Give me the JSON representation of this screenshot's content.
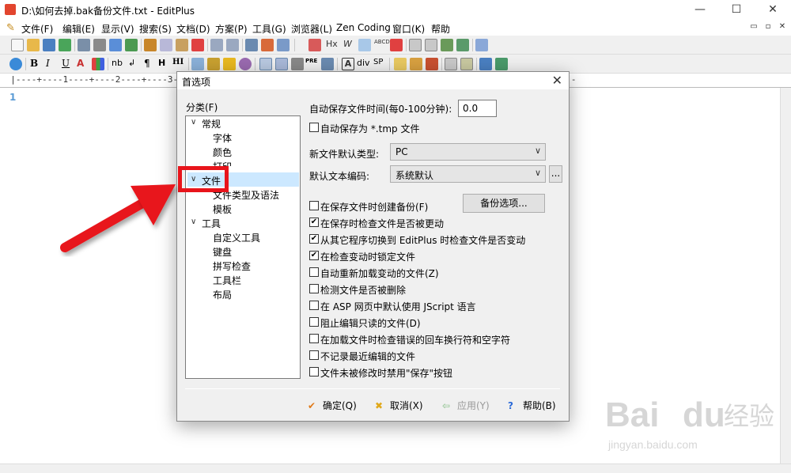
{
  "window": {
    "title": "D:\\如何去掉.bak备份文件.txt - EditPlus",
    "controls": [
      "—",
      "☐",
      "✕"
    ]
  },
  "menubar": {
    "items": [
      "文件(F)",
      "编辑(E)",
      "显示(V)",
      "搜索(S)",
      "文档(D)",
      "方案(P)",
      "工具(G)",
      "浏览器(L)",
      "Zen Coding",
      "窗口(K)",
      "帮助"
    ],
    "mdi_controls": [
      "▭",
      "▫",
      "✕"
    ]
  },
  "toolbar2_labels": {
    "b": "B",
    "i": "I",
    "u": "U",
    "nb": "nb",
    "pilcrow": "¶",
    "h": "H",
    "hi": "HI",
    "pre": "PRE",
    "div": "div",
    "sp": "SP",
    "a": "A",
    "hx": "Hx",
    "w": "W",
    "abcd": "ABCD"
  },
  "ruler": {
    "text": "  |----+----1----+----2----+----3----+----4----+----5----+----6----+----7----+----8----+----9----+----0-------"
  },
  "editor": {
    "line_number": "1"
  },
  "dialog": {
    "title": "首选项",
    "close": "✕",
    "category_label": "分类(F)",
    "tree": [
      {
        "label": "常规",
        "arrow": "∨"
      },
      {
        "label": "字体"
      },
      {
        "label": "颜色"
      },
      {
        "label": "打印"
      },
      {
        "label": "文件",
        "arrow": "∨"
      },
      {
        "label": "文件类型及语法"
      },
      {
        "label": "模板"
      },
      {
        "label": "工具",
        "arrow": "∨"
      },
      {
        "label": "自定义工具"
      },
      {
        "label": "键盘"
      },
      {
        "label": "拼写检查"
      },
      {
        "label": "工具栏"
      },
      {
        "label": "布局"
      }
    ],
    "autosave_label": "自动保存文件时间(每0-100分钟):",
    "autosave_value": "0.0",
    "autosave_tmp_label": "自动保存为 *.tmp 文件",
    "newfile_type_label": "新文件默认类型:",
    "newfile_type_value": "PC",
    "encoding_label": "默认文本编码:",
    "encoding_value": "系统默认",
    "encoding_more": "...",
    "backup_button": "备份选项...",
    "checkboxes": [
      {
        "label": "在保存文件时创建备份(F)",
        "checked": false
      },
      {
        "label": "在保存时检查文件是否被更动",
        "checked": true
      },
      {
        "label": "从其它程序切换到 EditPlus 时检查文件是否变动",
        "checked": true
      },
      {
        "label": "在检查变动时锁定文件",
        "checked": true
      },
      {
        "label": "自动重新加载变动的文件(Z)",
        "checked": false
      },
      {
        "label": "检测文件是否被删除",
        "checked": false
      },
      {
        "label": "在 ASP 网页中默认使用 JScript 语言",
        "checked": false
      },
      {
        "label": "阻止编辑只读的文件(D)",
        "checked": false
      },
      {
        "label": "在加载文件时检查错误的回车换行符和空字符",
        "checked": false
      },
      {
        "label": "不记录最近编辑的文件",
        "checked": false
      },
      {
        "label": "文件未被修改时禁用\"保存\"按钮",
        "checked": false
      }
    ],
    "footer": {
      "ok": "确定(Q)",
      "cancel": "取消(X)",
      "apply": "应用(Y)",
      "help": "帮助(B)",
      "ok_icon": "✔",
      "cancel_icon": "✖",
      "apply_icon": "⇦",
      "help_icon": "?"
    }
  },
  "watermark": {
    "brand": "Bai",
    "brand2": "du",
    "suffix": "经验",
    "url": "jingyan.baidu.com"
  },
  "colors": {
    "highlight": "#e8141b",
    "selection": "#cce8ff",
    "line_number": "#5b9bd5"
  }
}
